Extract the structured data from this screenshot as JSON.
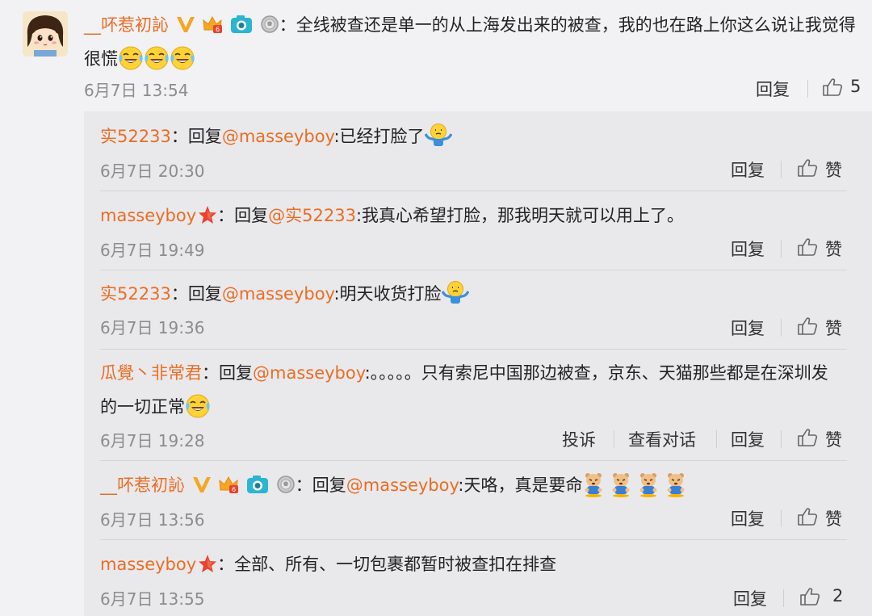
{
  "colors": {
    "accent": "#ea6d24",
    "text": "#222222",
    "muted": "#8c8c8c",
    "panel": "#e9e9ec",
    "background": "#f2f2f5"
  },
  "top_comment": {
    "user": "__吥惹初訫",
    "colon": "：",
    "text": "全线被查还是单一的从上海发出来的被查，我的也在路上你这么说让我觉得很慌",
    "time": "6月7日 13:54",
    "reply_label": "回复",
    "like_count": "5"
  },
  "replies": [
    {
      "user": "实52233",
      "colon": "：",
      "prefix": "回复",
      "mention": "@masseyboy",
      "text": ":已经打脸了",
      "time": "6月7日 20:30",
      "actions": [
        "回复"
      ],
      "like_label": "赞"
    },
    {
      "user": "masseyboy",
      "colon": "：",
      "prefix": "回复",
      "mention": "@实52233",
      "text": ":我真心希望打脸，那我明天就可以用上了。",
      "time": "6月7日 19:49",
      "actions": [
        "回复"
      ],
      "like_label": "赞"
    },
    {
      "user": "实52233",
      "colon": "：",
      "prefix": "回复",
      "mention": "@masseyboy",
      "text": ":明天收货打脸",
      "time": "6月7日 19:36",
      "actions": [
        "回复"
      ],
      "like_label": "赞"
    },
    {
      "user": "瓜覺丶非常君",
      "colon": "：",
      "prefix": "回复",
      "mention": "@masseyboy",
      "text": ":。。。。。只有索尼中国那边被查，京东、天猫那些都是在深圳发的一切正常",
      "time": "6月7日 19:28",
      "actions": [
        "投诉",
        "查看对话",
        "回复"
      ],
      "like_label": "赞"
    },
    {
      "user": "__吥惹初訫",
      "colon": "：",
      "prefix": "回复",
      "mention": "@masseyboy",
      "text": ":天咯，真是要命",
      "time": "6月7日 13:56",
      "actions": [
        "回复"
      ],
      "like_label": "赞"
    },
    {
      "user": "masseyboy",
      "colon": "：",
      "text": "全部、所有、一切包裹都暂时被查扣在排查",
      "time": "6月7日 13:55",
      "actions": [
        "回复"
      ],
      "like_label": "2"
    }
  ]
}
